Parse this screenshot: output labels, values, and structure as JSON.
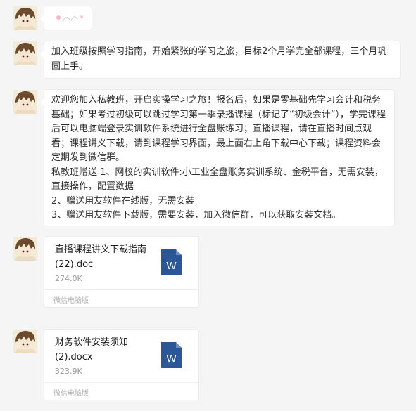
{
  "messages": [
    {
      "type": "emoji",
      "icon": "flower-sticker-icon"
    },
    {
      "type": "text",
      "text": "加入班级按照学习指南，开始紧张的学习之旅，目标2个月学完全部课程，三个月巩固上手。"
    },
    {
      "type": "text",
      "text": "欢迎您加入私教班，开启实操学习之旅！报名后，如果是零基础先学习会计和税务基础；如果考过初级可以跳过学习第一季录播课程（标记了“初级会计”），学完课程后可以电脑端登录实训软件系统进行全盘账练习；直播课程，请在直播时间点观看；课程讲义下载，请到课程学习界面，最上面右上角下载中心下载；课程资料会定期发到微信群。\n私教班赠送 1、网校的实训软件:小工业全盘账务实训系统、金税平台，无需安装，直接操作，配置数据\n2、赠送用友软件在线版，无需安装\n3、赠送用友软件下载版，需要安装，加入微信群，可以获取安装文档。"
    },
    {
      "type": "file",
      "name": "直播课程讲义下载指南(22).doc",
      "size": "274.0K",
      "source": "微信电脑版",
      "icon": "word-document-icon",
      "icon_letter": "W"
    },
    {
      "type": "file",
      "name": "财务软件安装须知(2).docx",
      "size": "323.9K",
      "source": "微信电脑版",
      "icon": "word-document-icon",
      "icon_letter": "W"
    }
  ],
  "colors": {
    "background": "#f5f5f5",
    "bubble": "#ffffff",
    "word_blue": "#2b5797"
  }
}
